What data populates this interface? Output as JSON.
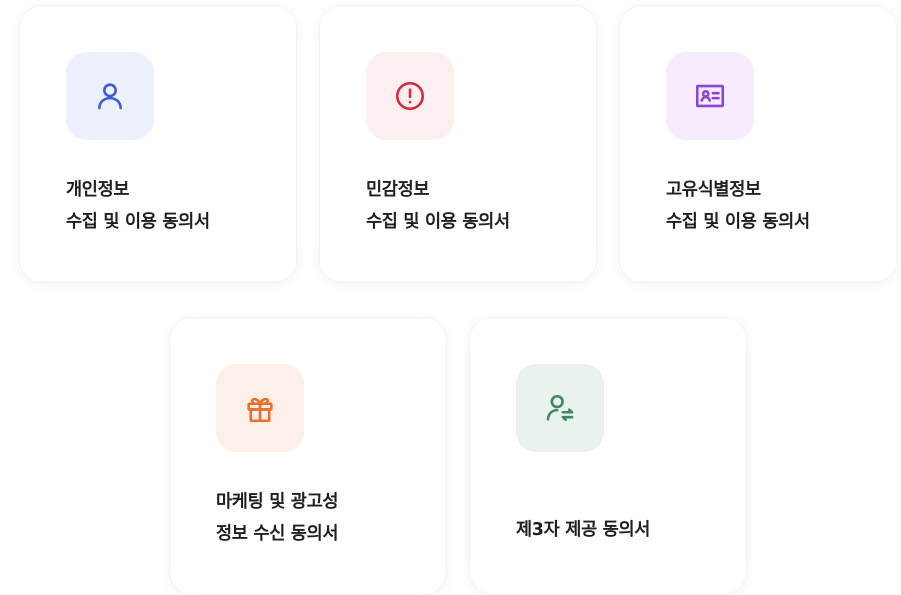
{
  "cards": [
    {
      "icon": "person-icon",
      "icon_color": "#3b5bdb",
      "icon_bg": "#ecf1fd",
      "title_lines": [
        "개인정보",
        "수집 및 이용 동의서"
      ]
    },
    {
      "icon": "alert-circle-icon",
      "icon_color": "#d3293b",
      "icon_bg": "#fdeff0",
      "title_lines": [
        "민감정보",
        "수집 및 이용 동의서"
      ]
    },
    {
      "icon": "id-card-icon",
      "icon_color": "#8b45d6",
      "icon_bg": "#f6ecfe",
      "title_lines": [
        "고유식별정보",
        "수집 및 이용 동의서"
      ]
    },
    {
      "icon": "gift-icon",
      "icon_color": "#e8702a",
      "icon_bg": "#fdf0e8",
      "title_lines": [
        "마케팅 및 광고성",
        "정보 수신 동의서"
      ]
    },
    {
      "icon": "person-transfer-icon",
      "icon_color": "#3d8a5e",
      "icon_bg": "#e9f2ec",
      "title_lines": [
        "제3자 제공 동의서"
      ]
    }
  ]
}
